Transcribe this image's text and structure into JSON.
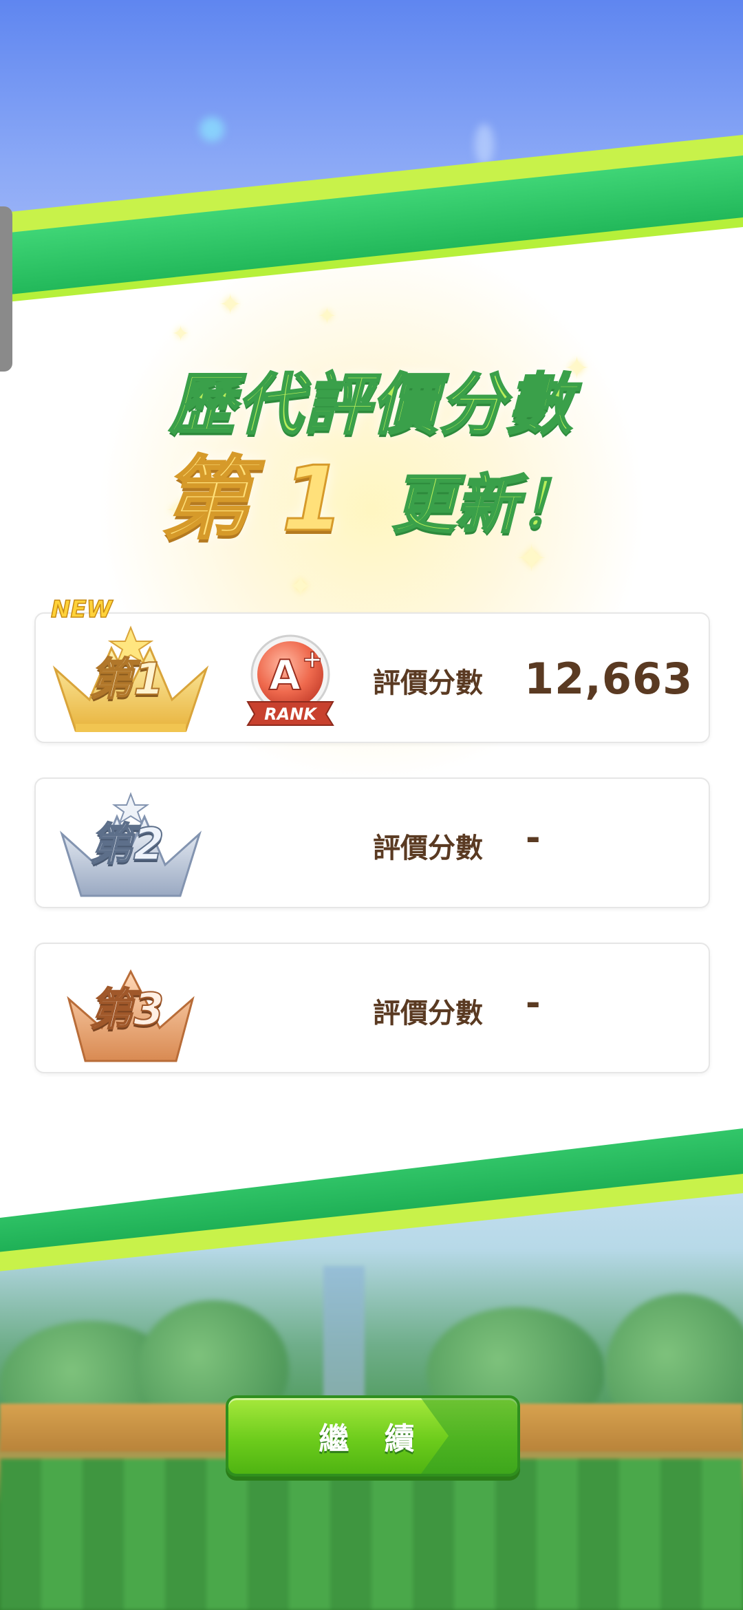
{
  "header": {
    "title": "歷代評價分數",
    "rank_text": "第 1",
    "updated_text": "更新！"
  },
  "rankings": [
    {
      "place_label": "第1",
      "is_new": true,
      "new_label": "NEW",
      "rank_badge": "A+",
      "rank_badge_sub": "RANK",
      "score_label": "評價分數",
      "score": "12,663",
      "crown": "gold-crown-icon"
    },
    {
      "place_label": "第2",
      "is_new": false,
      "score_label": "評價分數",
      "score": "-",
      "crown": "silver-crown-icon"
    },
    {
      "place_label": "第3",
      "is_new": false,
      "score_label": "評價分數",
      "score": "-",
      "crown": "bronze-crown-icon"
    }
  ],
  "footer": {
    "continue_label": "繼 續"
  },
  "colors": {
    "accent_green": "#6dcc1c",
    "stripe_green": "#2ecc6a",
    "stripe_lime": "#b6f03a",
    "score_brown": "#5a3a22",
    "gold": "#ffd23a"
  }
}
